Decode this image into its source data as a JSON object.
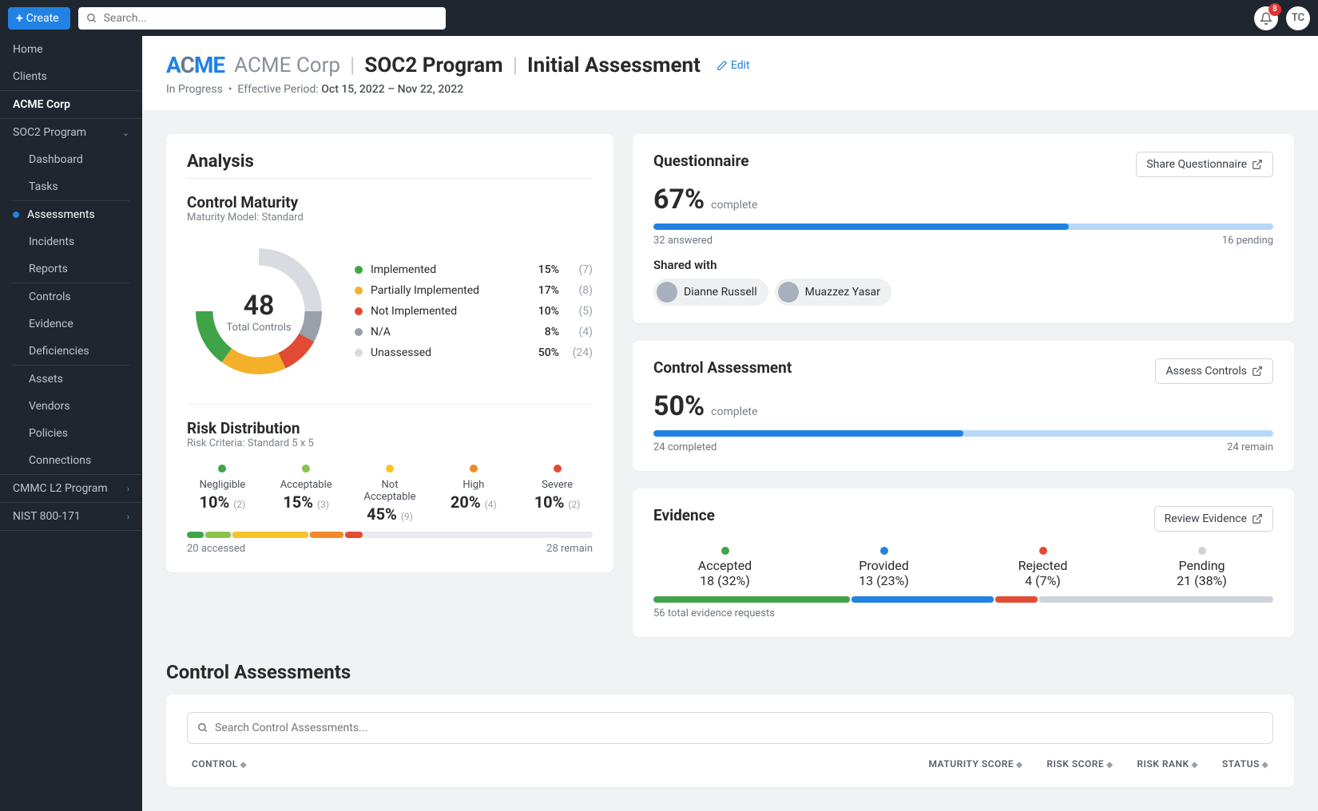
{
  "topbar": {
    "create": "Create",
    "search_placeholder": "Search...",
    "notif_count": "8",
    "avatar": "TC"
  },
  "sidebar": {
    "home": "Home",
    "clients": "Clients",
    "org": "ACME Corp",
    "prog": "SOC2 Program",
    "sub": {
      "dashboard": "Dashboard",
      "tasks": "Tasks",
      "assessments": "Assessments",
      "incidents": "Incidents",
      "reports": "Reports",
      "controls": "Controls",
      "evidence": "Evidence",
      "deficiencies": "Deficiencies",
      "assets": "Assets",
      "vendors": "Vendors",
      "policies": "Policies",
      "connections": "Connections"
    },
    "prog2": "CMMC L2 Program",
    "prog3": "NIST 800-171"
  },
  "header": {
    "org": "ACME Corp",
    "program": "SOC2 Program",
    "assessment": "Initial Assessment",
    "edit": "Edit",
    "status": "In Progress",
    "period_label": "Effective Period:",
    "period": "Oct 15, 2022 – Nov 22, 2022"
  },
  "analysis": {
    "title": "Analysis",
    "maturity": {
      "title": "Control Maturity",
      "model": "Maturity Model: Standard",
      "total": "48",
      "total_label": "Total Controls",
      "rows": [
        {
          "label": "Implemented",
          "pct": "15%",
          "count": "(7)",
          "color": "#3fa447"
        },
        {
          "label": "Partially Implemented",
          "pct": "17%",
          "count": "(8)",
          "color": "#f4b029"
        },
        {
          "label": "Not Implemented",
          "pct": "10%",
          "count": "(5)",
          "color": "#e24b33"
        },
        {
          "label": "N/A",
          "pct": "8%",
          "count": "(4)",
          "color": "#9aa0a9"
        },
        {
          "label": "Unassessed",
          "pct": "50%",
          "count": "(24)",
          "color": "#d8dbe0"
        }
      ]
    },
    "risk": {
      "title": "Risk Distribution",
      "model": "Risk Criteria: Standard 5 x 5",
      "cells": [
        {
          "label": "Negligible",
          "pct": "10%",
          "count": "(2)",
          "color": "#3fa447"
        },
        {
          "label": "Acceptable",
          "pct": "15%",
          "count": "(3)",
          "color": "#8bc34a"
        },
        {
          "label": "Not Acceptable",
          "pct": "45%",
          "count": "(9)",
          "color": "#f4c429"
        },
        {
          "label": "High",
          "pct": "20%",
          "count": "(4)",
          "color": "#f08a2a"
        },
        {
          "label": "Severe",
          "pct": "10%",
          "count": "(2)",
          "color": "#e24b33"
        }
      ],
      "foot_l": "20 accessed",
      "foot_r": "28 remain"
    }
  },
  "questionnaire": {
    "title": "Questionnaire",
    "share": "Share Questionnaire",
    "pct": "67%",
    "suffix": "complete",
    "fill": 67,
    "foot_l": "32 answered",
    "foot_r": "16 pending",
    "shared_title": "Shared with",
    "people": [
      "Dianne Russell",
      "Muazzez Yasar"
    ]
  },
  "control_assessment": {
    "title": "Control Assessment",
    "action": "Assess Controls",
    "pct": "50%",
    "suffix": "complete",
    "fill": 50,
    "foot_l": "24 completed",
    "foot_r": "24 remain"
  },
  "evidence": {
    "title": "Evidence",
    "action": "Review Evidence",
    "cells": [
      {
        "label": "Accepted",
        "val": "18",
        "count": "(32%)",
        "color": "#3fa447"
      },
      {
        "label": "Provided",
        "val": "13",
        "count": "(23%)",
        "color": "#2182e3"
      },
      {
        "label": "Rejected",
        "val": "4",
        "count": "(7%)",
        "color": "#e24b33"
      },
      {
        "label": "Pending",
        "val": "21",
        "count": "(38%)",
        "color": "#cfd3d9"
      }
    ],
    "foot": "56 total evidence requests"
  },
  "table": {
    "title": "Control Assessments",
    "search_placeholder": "Search Control Assessments...",
    "cols": {
      "control": "CONTROL",
      "mscore": "MATURITY SCORE",
      "rscore": "RISK SCORE",
      "rrank": "RISK RANK",
      "status": "STATUS"
    }
  },
  "chart_data": {
    "type": "pie",
    "title": "Control Maturity",
    "categories": [
      "Implemented",
      "Partially Implemented",
      "Not Implemented",
      "N/A",
      "Unassessed"
    ],
    "values": [
      15,
      17,
      10,
      8,
      50
    ],
    "counts": [
      7,
      8,
      5,
      4,
      24
    ],
    "colors": [
      "#3fa447",
      "#f4b029",
      "#e24b33",
      "#9aa0a9",
      "#d8dbe0"
    ],
    "total": 48
  }
}
